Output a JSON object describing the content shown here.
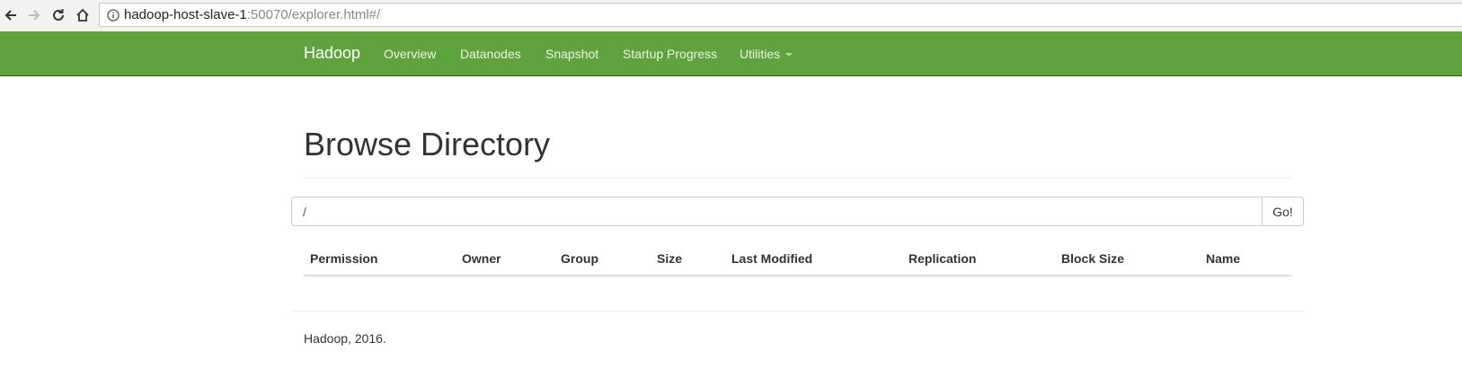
{
  "browser": {
    "url_host": "hadoop-host-slave-1",
    "url_rest": ":50070/explorer.html#/"
  },
  "navbar": {
    "brand": "Hadoop",
    "links": [
      "Overview",
      "Datanodes",
      "Snapshot",
      "Startup Progress",
      "Utilities"
    ],
    "background_color": "#5fa33e"
  },
  "page": {
    "title": "Browse Directory",
    "path_value": "/",
    "go_label": "Go!"
  },
  "table": {
    "columns": [
      "Permission",
      "Owner",
      "Group",
      "Size",
      "Last Modified",
      "Replication",
      "Block Size",
      "Name"
    ],
    "rows": []
  },
  "footer": {
    "text": "Hadoop, 2016."
  }
}
